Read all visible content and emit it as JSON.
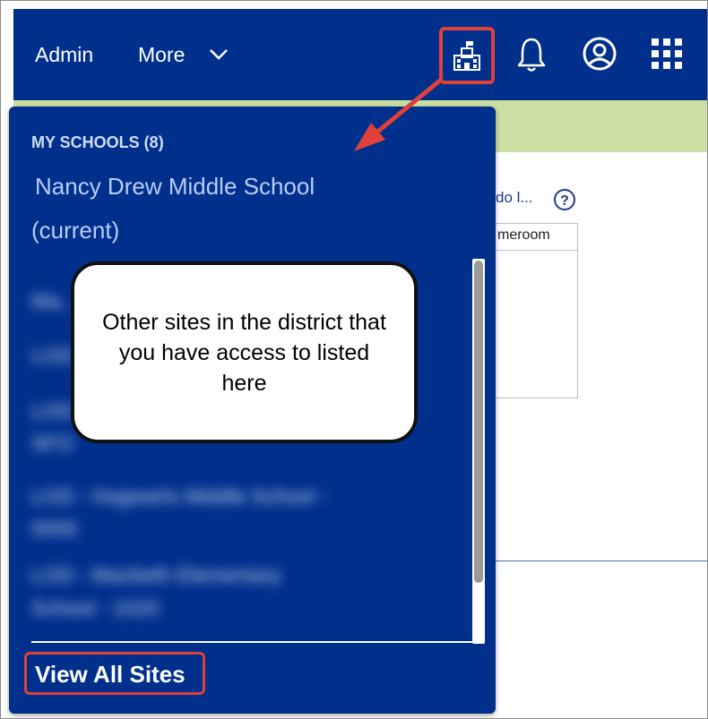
{
  "nav": {
    "admin_label": "Admin",
    "more_label": "More"
  },
  "page": {
    "truncated_link": "do l...",
    "table_header": "meroom"
  },
  "dropdown": {
    "heading": "MY SCHOOLS (8)",
    "current_school": "Nancy Drew Middle School",
    "current_tag": "(current)",
    "other_sites_blurred": [
      "Ma...",
      "LOD...",
      "LOD... Elementary",
      "SFO",
      "LOD - Hogwarts Middle School -",
      "0000",
      "LOD - Macbeth Elementary",
      "School - 1020"
    ],
    "view_all_label": "View All Sites"
  },
  "callout": {
    "text": "Other sites in the district that you have access to listed here"
  },
  "colors": {
    "nav_blue": "#00308c",
    "highlight_red": "#e0403a",
    "banner_green": "#cadfa1"
  }
}
